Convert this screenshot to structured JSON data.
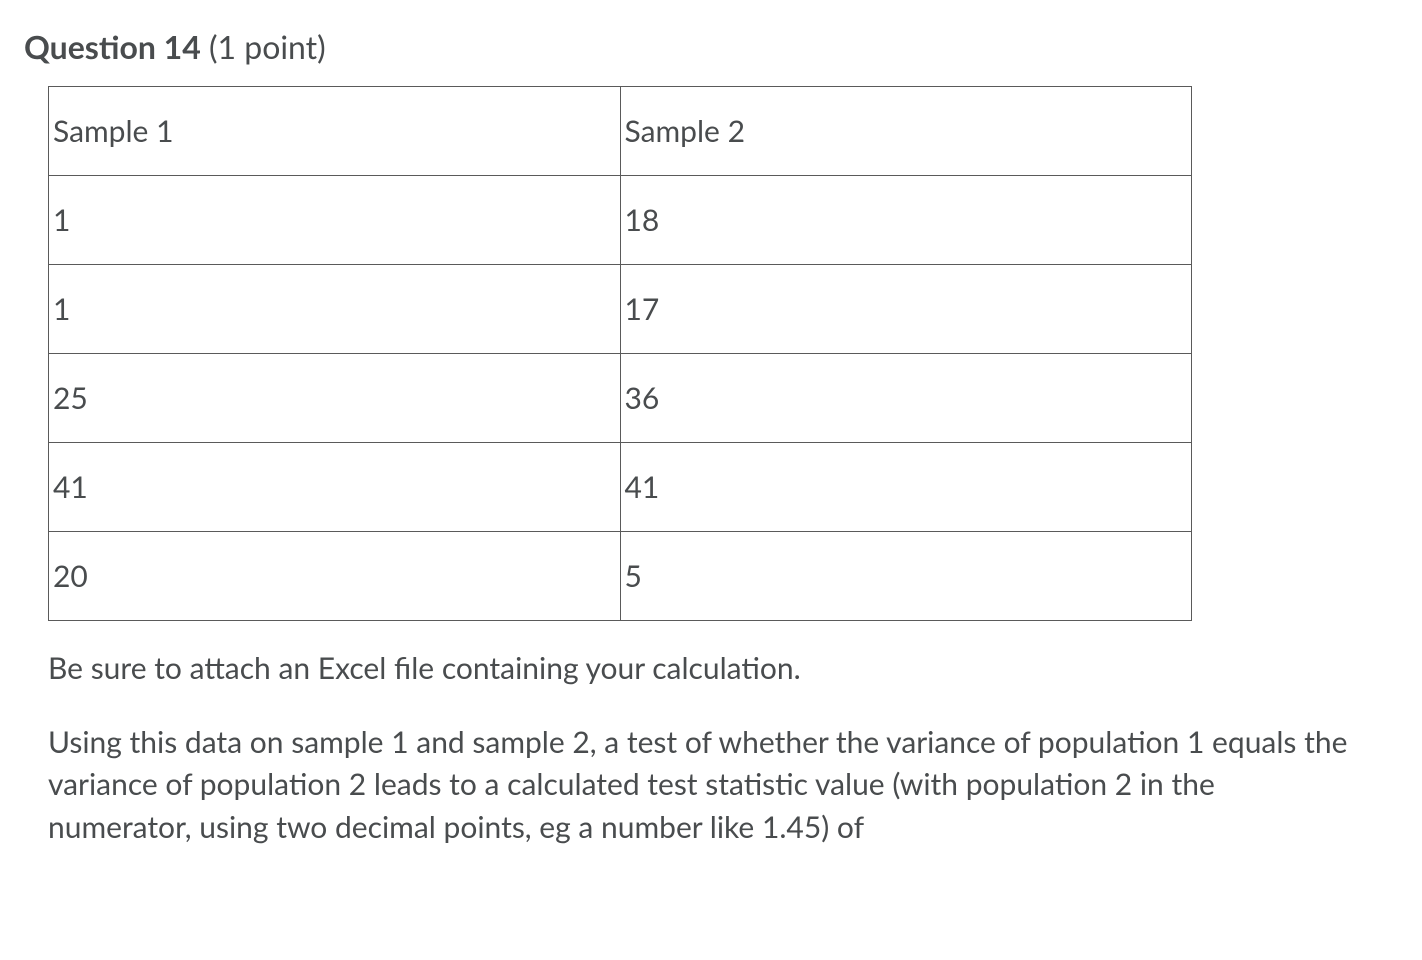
{
  "header": {
    "label": "Question 14",
    "points": "(1 point)"
  },
  "table": {
    "headers": [
      "Sample 1",
      "Sample 2"
    ],
    "rows": [
      [
        "1",
        "18"
      ],
      [
        "1",
        "17"
      ],
      [
        "25",
        "36"
      ],
      [
        "41",
        "41"
      ],
      [
        "20",
        "5"
      ]
    ]
  },
  "instruction": "Be sure to attach an Excel file containing your calculation.",
  "prompt": "Using this data on sample 1 and sample 2, a test of whether the variance of population 1 equals the variance of population 2 leads to a calculated test statistic value (with population 2 in the numerator, using two decimal points, eg a number like 1.45) of"
}
